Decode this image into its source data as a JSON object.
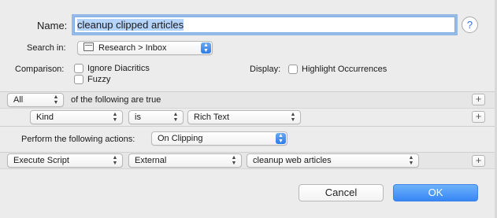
{
  "name": {
    "label": "Name:",
    "value": "cleanup clipped articles",
    "help": "?"
  },
  "search_in": {
    "label": "Search in:",
    "value": "Research > Inbox",
    "icon": "database-icon"
  },
  "comparison": {
    "label": "Comparison:",
    "options": [
      {
        "label": "Ignore Diacritics",
        "checked": false
      },
      {
        "label": "Fuzzy",
        "checked": false
      }
    ]
  },
  "display": {
    "label": "Display:",
    "option": {
      "label": "Highlight Occurrences",
      "checked": false
    }
  },
  "match": {
    "quantifier": "All",
    "suffix": "of the following are true",
    "add": "+"
  },
  "condition": {
    "field": "Kind",
    "operator": "is",
    "value": "Rich Text",
    "add": "+"
  },
  "actions": {
    "label": "Perform the following actions:",
    "trigger": "On Clipping"
  },
  "action_row": {
    "action": "Execute Script",
    "source": "External",
    "script": "cleanup web articles",
    "add": "+"
  },
  "buttons": {
    "cancel": "Cancel",
    "ok": "OK"
  },
  "colors": {
    "accent": "#3786f5",
    "selection": "#b4d4fb",
    "background": "#ececec"
  }
}
